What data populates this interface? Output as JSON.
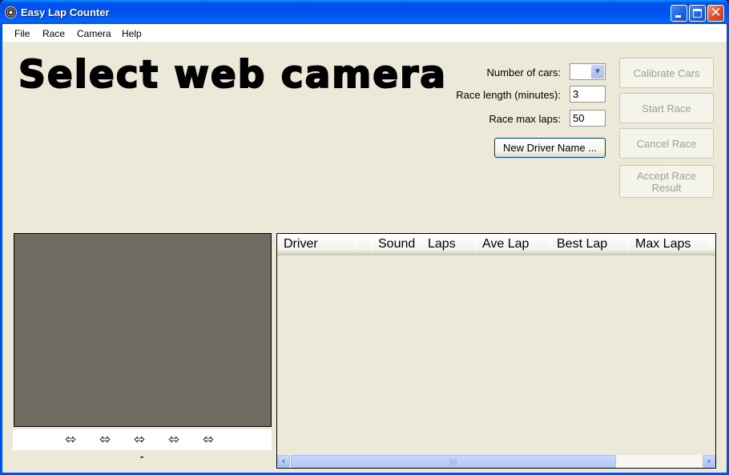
{
  "window": {
    "title": "Easy Lap Counter",
    "icon": "film-reel-icon",
    "controls": {
      "minimize": "minimize-icon",
      "maximize": "maximize-icon",
      "close": "close-icon"
    }
  },
  "menu": {
    "items": [
      "File",
      "Race",
      "Camera",
      "Help"
    ]
  },
  "status_heading": "Select web camera",
  "settings": {
    "num_cars_label": "Number of cars:",
    "num_cars_value": "",
    "race_length_label": "Race length (minutes):",
    "race_length_value": "3",
    "max_laps_label": "Race max laps:",
    "max_laps_value": "50",
    "new_driver_button": "New Driver Name ..."
  },
  "actions": {
    "calibrate": "Calibrate Cars",
    "start": "Start Race",
    "cancel": "Cancel Race",
    "accept_line1": "Accept Race",
    "accept_line2": "Result",
    "enabled": false
  },
  "camera_panel": {
    "lane_arrows": [
      "⬄",
      "⬄",
      "⬄",
      "⬄",
      "⬄"
    ],
    "status_text": "-"
  },
  "results_table": {
    "columns": [
      "Driver",
      "",
      "Sound",
      "Laps",
      "Ave Lap",
      "Best Lap",
      "Max Laps"
    ],
    "rows": []
  }
}
